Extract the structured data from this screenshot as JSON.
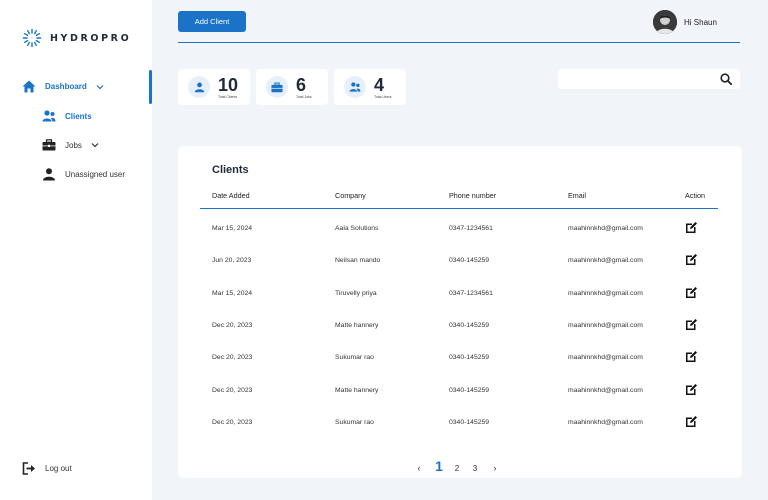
{
  "brand": {
    "name": "HYDROPRO",
    "accent": "#1a73c7"
  },
  "sidebar": {
    "items": [
      {
        "label": "Dashboard",
        "icon": "home-icon"
      },
      {
        "label": "Clients",
        "icon": "users-icon"
      },
      {
        "label": "Jobs",
        "icon": "briefcase-icon"
      },
      {
        "label": "Unassigned user",
        "icon": "user-icon"
      }
    ],
    "logout": {
      "label": "Log out",
      "icon": "logout-icon"
    }
  },
  "header": {
    "add_client_label": "Add Client",
    "greeting": "Hi Shaun"
  },
  "stats": [
    {
      "value": "10",
      "label": "Total Clients",
      "icon": "user-icon"
    },
    {
      "value": "6",
      "label": "Total Jobs",
      "icon": "briefcase-icon"
    },
    {
      "value": "4",
      "label": "Total Users",
      "icon": "users-icon"
    }
  ],
  "search": {
    "placeholder": ""
  },
  "clients": {
    "title": "Clients",
    "columns": [
      "Date Added",
      "Company",
      "Phone number",
      "Email",
      "Action"
    ],
    "rows": [
      [
        "Mar 15, 2024",
        "Aala Solutions",
        "0347-1234561",
        "maahinnkhd@gmail.com"
      ],
      [
        "Jun 20, 2023",
        "Neilsan mando",
        "0340-145259",
        "maahinnkhd@gmail.com"
      ],
      [
        "Mar 15, 2024",
        "Tiruvelly priya",
        "0347-1234561",
        "maahinnkhd@gmail.com"
      ],
      [
        "Dec 20, 2023",
        "Matte hannery",
        "0340-145259",
        "maahinnkhd@gmail.com"
      ],
      [
        "Dec 20, 2023",
        "Sukumar rao",
        "0340-145259",
        "maahinnkhd@gmail.com"
      ],
      [
        "Dec 20, 2023",
        "Matte hannery",
        "0340-145259",
        "maahinnkhd@gmail.com"
      ],
      [
        "Dec 20, 2023",
        "Sukumar rao",
        "0340-145259",
        "maahinnkhd@gmail.com"
      ]
    ],
    "action_icon": "edit-icon"
  },
  "pagination": {
    "prev": "‹",
    "pages": [
      "1",
      "2",
      "3"
    ],
    "current": "1",
    "next": "›"
  }
}
